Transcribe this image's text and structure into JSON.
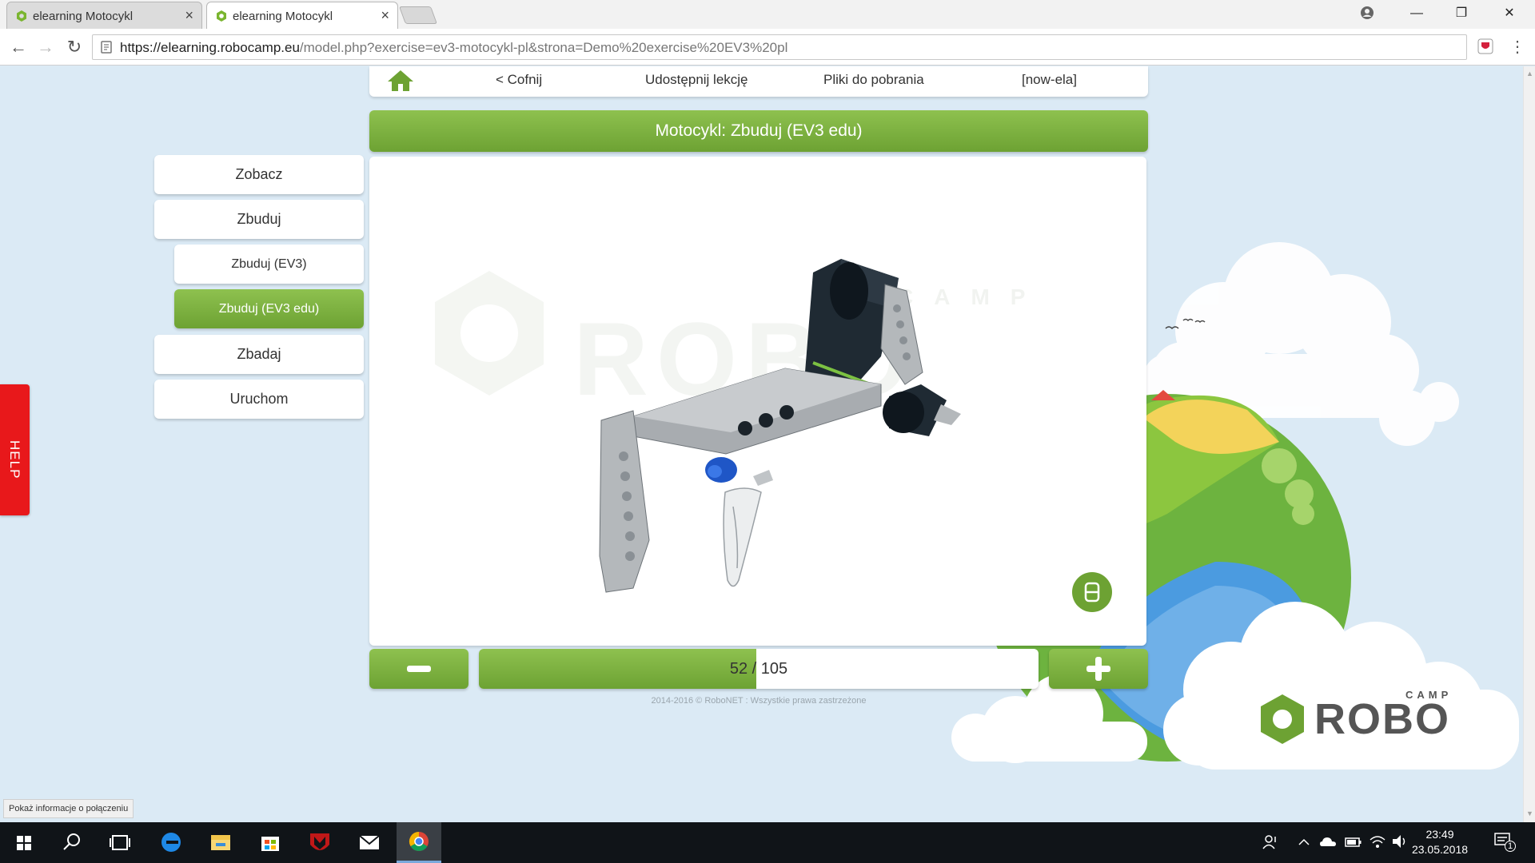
{
  "browser": {
    "tabs": [
      {
        "title": "elearning Motocykl",
        "close": "×"
      },
      {
        "title": "elearning Motocykl",
        "close": "×"
      }
    ],
    "window_controls": {
      "minimize": "—",
      "restore": "❐",
      "close": "✕"
    },
    "url_host": "https://elearning.robocamp.eu",
    "url_path": "/model.php?exercise=ev3-motocykl-pl&strona=Demo%20exercise%20EV3%20pl",
    "nav": {
      "back": "←",
      "forward": "→",
      "reload": "↻"
    },
    "menu": "⋮"
  },
  "topnav": {
    "back_label": "< Cofnij",
    "share_label": "Udostępnij lekcję",
    "downloads_label": "Pliki do pobrania",
    "user_label": "[now-ela]"
  },
  "page_title": "Motocykl: Zbuduj (EV3 edu)",
  "sidebar": {
    "items": [
      {
        "label": "Zobacz"
      },
      {
        "label": "Zbuduj"
      },
      {
        "label": "Zbuduj (EV3)"
      },
      {
        "label": "Zbuduj (EV3 edu)"
      },
      {
        "label": "Zbadaj"
      },
      {
        "label": "Uruchom"
      }
    ]
  },
  "viewer": {
    "watermark_brand": "ROBO",
    "watermark_small": "CAMP"
  },
  "stepper": {
    "current": "52",
    "separator": "/",
    "total": "105",
    "progress_fraction": 0.495
  },
  "footer": "2014-2016 © RoboNET : Wszystkie prawa zastrzeżone",
  "help_label": "HELP",
  "status_tooltip": "Pokaż informacje o połączeniu",
  "brand": {
    "logo_main": "ROBO",
    "logo_small": "CAMP"
  },
  "taskbar": {
    "time": "23:49",
    "date": "23.05.2018",
    "notifications": "1"
  },
  "colors": {
    "green_top": "#8ec14f",
    "green_bottom": "#6da233",
    "help_red": "#e8181b",
    "page_bg": "#dbeaf5"
  }
}
